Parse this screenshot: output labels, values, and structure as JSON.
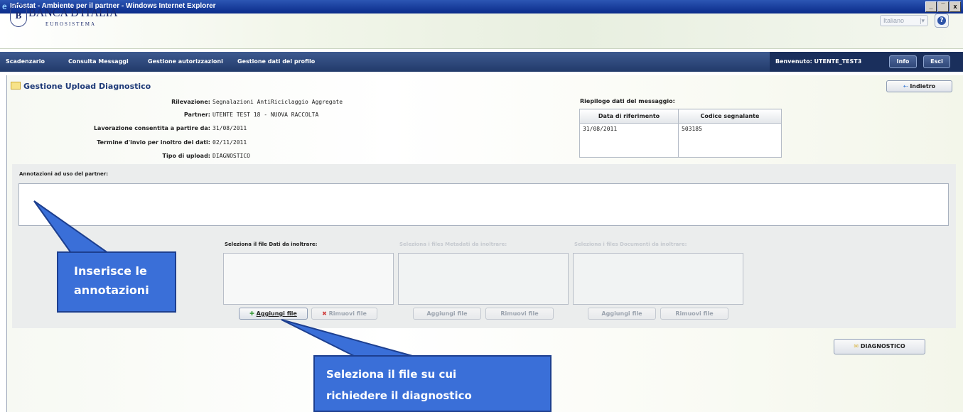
{
  "window": {
    "title": "Infostat - Ambiente per il partner - Windows Internet Explorer",
    "controls": [
      "_",
      "̅",
      "x"
    ]
  },
  "header": {
    "logo_glyph": "B",
    "brand": "BANCA D'ITALIA",
    "brand_sub": "EUROSISTEMA",
    "language": "Italiano",
    "language_arrow": "|▾",
    "help": "?"
  },
  "nav": {
    "items": [
      "Scadenzario",
      "Consulta Messaggi",
      "Gestione autorizzazioni",
      "Gestione dati del profilo"
    ],
    "welcome": "Benvenuto:  UTENTE_TEST3",
    "info": "Info",
    "exit": "Esci"
  },
  "page": {
    "title": "Gestione Upload Diagnostico",
    "back_button": "Indietro",
    "fields": [
      {
        "label": "Rilevazione:",
        "value": "Segnalazioni AntiRiciclaggio Aggregate"
      },
      {
        "label": "Partner:",
        "value": "UTENTE TEST 18 - NUOVA RACCOLTA"
      },
      {
        "label": "Lavorazione consentita a partire da:",
        "value": "31/08/2011"
      },
      {
        "label": "Termine d'invio per inoltro dei dati:",
        "value": "02/11/2011"
      },
      {
        "label": "Tipo di upload:",
        "value": "DIAGNOSTICO"
      }
    ],
    "summary": {
      "title": "Riepilogo dati del messaggio:",
      "columns": [
        "Data di riferimento",
        "Codice segnalante"
      ],
      "rows": [
        [
          "31/08/2011",
          "503185"
        ]
      ]
    },
    "annotations_label": "Annotazioni ad uso del partner:",
    "annotations_value": "",
    "uploads": [
      {
        "label": "Seleziona il file Dati da inoltrare:",
        "add": "Aggiungi file",
        "remove": "Rimuovi file",
        "enabled": true
      },
      {
        "label": "Seleziona i files Metadati da inoltrare:",
        "add": "Aggiungi file",
        "remove": "Rimuovi file",
        "enabled": false
      },
      {
        "label": "Seleziona i files Documenti da inoltrare:",
        "add": "Aggiungi file",
        "remove": "Rimuovi file",
        "enabled": false
      }
    ],
    "diagnostic_button": "DIAGNOSTICO"
  },
  "callouts": {
    "annotations": [
      "Inserisce le",
      "annotazioni"
    ],
    "file": [
      "Seleziona il file su cui",
      "richiedere il diagnostico"
    ]
  },
  "colors": {
    "nav": "#2f4a80",
    "callout": "#3a6fd8",
    "panel": "#ebeded"
  }
}
